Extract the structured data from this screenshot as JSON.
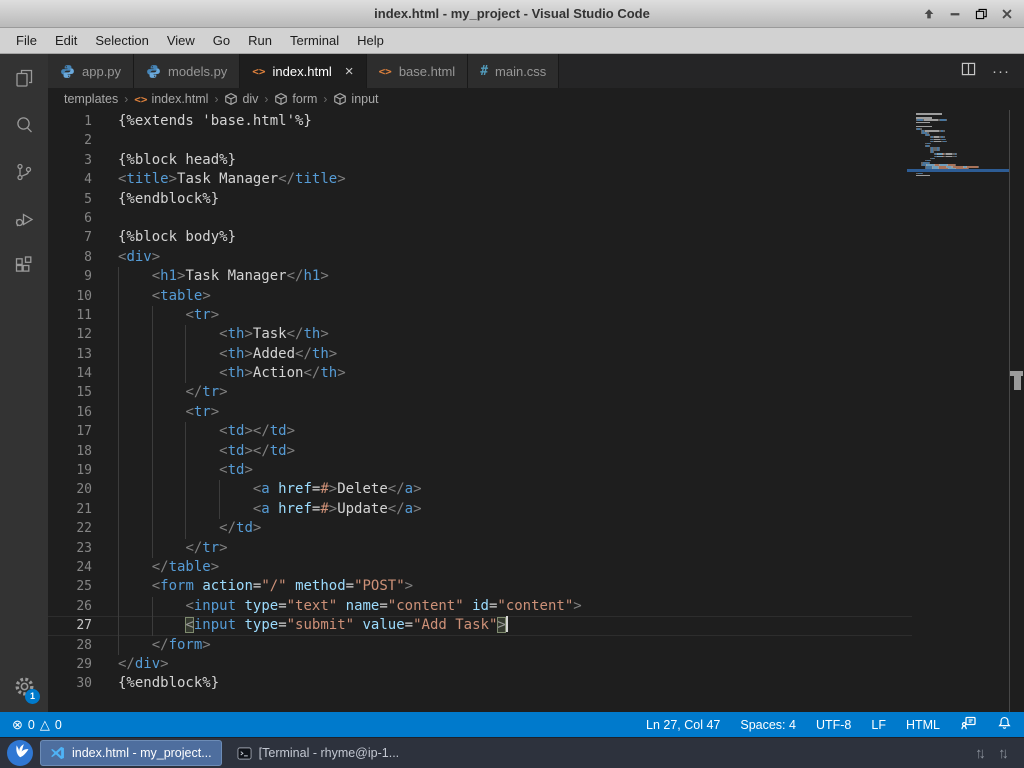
{
  "window": {
    "title": "index.html - my_project - Visual Studio Code"
  },
  "window_controls": [
    {
      "name": "shade-button",
      "icon": "arrow-up-icon"
    },
    {
      "name": "minimize-button",
      "icon": "minimize-icon"
    },
    {
      "name": "maximize-button",
      "icon": "maximize-icon"
    },
    {
      "name": "close-button",
      "icon": "close-icon"
    }
  ],
  "menubar": {
    "items": [
      "File",
      "Edit",
      "Selection",
      "View",
      "Go",
      "Run",
      "Terminal",
      "Help"
    ]
  },
  "activitybar": {
    "items": [
      "explorer",
      "search",
      "source-control",
      "run-debug",
      "extensions"
    ],
    "settings_icon": "gear-icon",
    "settings_badge": "1"
  },
  "tabs": [
    {
      "label": "app.py",
      "icon": "python-icon",
      "active": false
    },
    {
      "label": "models.py",
      "icon": "python-icon",
      "active": false
    },
    {
      "label": "index.html",
      "icon": "html-icon",
      "active": true,
      "close_label": "×"
    },
    {
      "label": "base.html",
      "icon": "html-icon",
      "active": false
    },
    {
      "label": "main.css",
      "icon": "css-icon",
      "active": false
    }
  ],
  "tab_actions": {
    "split_icon": "split-editor-icon",
    "more_label": "···"
  },
  "breadcrumb": {
    "separator": "›",
    "items": [
      {
        "label": "templates",
        "icon": null
      },
      {
        "label": "index.html",
        "icon": "html-icon"
      },
      {
        "label": "div",
        "icon": "symbol-cube-icon"
      },
      {
        "label": "form",
        "icon": "symbol-cube-icon"
      },
      {
        "label": "input",
        "icon": "symbol-cube-icon"
      }
    ]
  },
  "editor": {
    "active_line": 27,
    "lines": [
      {
        "n": 1,
        "indent": 0,
        "t": [
          [
            "p",
            "{%extends 'base.html'%}"
          ]
        ]
      },
      {
        "n": 2,
        "indent": 0,
        "t": []
      },
      {
        "n": 3,
        "indent": 0,
        "t": [
          [
            "p",
            "{%block head%}"
          ]
        ]
      },
      {
        "n": 4,
        "indent": 0,
        "t": [
          [
            "b",
            "<"
          ],
          [
            "t",
            "title"
          ],
          [
            "b",
            ">"
          ],
          [
            "p",
            "Task Manager"
          ],
          [
            "b",
            "</"
          ],
          [
            "t",
            "title"
          ],
          [
            "b",
            ">"
          ]
        ]
      },
      {
        "n": 5,
        "indent": 0,
        "t": [
          [
            "p",
            "{%endblock%}"
          ]
        ]
      },
      {
        "n": 6,
        "indent": 0,
        "t": []
      },
      {
        "n": 7,
        "indent": 0,
        "t": [
          [
            "p",
            "{%block body%}"
          ]
        ]
      },
      {
        "n": 8,
        "indent": 0,
        "t": [
          [
            "b",
            "<"
          ],
          [
            "t",
            "div"
          ],
          [
            "b",
            ">"
          ]
        ]
      },
      {
        "n": 9,
        "indent": 4,
        "t": [
          [
            "b",
            "<"
          ],
          [
            "t",
            "h1"
          ],
          [
            "b",
            ">"
          ],
          [
            "p",
            "Task Manager"
          ],
          [
            "b",
            "</"
          ],
          [
            "t",
            "h1"
          ],
          [
            "b",
            ">"
          ]
        ]
      },
      {
        "n": 10,
        "indent": 4,
        "t": [
          [
            "b",
            "<"
          ],
          [
            "t",
            "table"
          ],
          [
            "b",
            ">"
          ]
        ]
      },
      {
        "n": 11,
        "indent": 8,
        "t": [
          [
            "b",
            "<"
          ],
          [
            "t",
            "tr"
          ],
          [
            "b",
            ">"
          ]
        ]
      },
      {
        "n": 12,
        "indent": 12,
        "t": [
          [
            "b",
            "<"
          ],
          [
            "t",
            "th"
          ],
          [
            "b",
            ">"
          ],
          [
            "p",
            "Task"
          ],
          [
            "b",
            "</"
          ],
          [
            "t",
            "th"
          ],
          [
            "b",
            ">"
          ]
        ]
      },
      {
        "n": 13,
        "indent": 12,
        "t": [
          [
            "b",
            "<"
          ],
          [
            "t",
            "th"
          ],
          [
            "b",
            ">"
          ],
          [
            "p",
            "Added"
          ],
          [
            "b",
            "</"
          ],
          [
            "t",
            "th"
          ],
          [
            "b",
            ">"
          ]
        ]
      },
      {
        "n": 14,
        "indent": 12,
        "t": [
          [
            "b",
            "<"
          ],
          [
            "t",
            "th"
          ],
          [
            "b",
            ">"
          ],
          [
            "p",
            "Action"
          ],
          [
            "b",
            "</"
          ],
          [
            "t",
            "th"
          ],
          [
            "b",
            ">"
          ]
        ]
      },
      {
        "n": 15,
        "indent": 8,
        "t": [
          [
            "b",
            "</"
          ],
          [
            "t",
            "tr"
          ],
          [
            "b",
            ">"
          ]
        ]
      },
      {
        "n": 16,
        "indent": 8,
        "t": [
          [
            "b",
            "<"
          ],
          [
            "t",
            "tr"
          ],
          [
            "b",
            ">"
          ]
        ]
      },
      {
        "n": 17,
        "indent": 12,
        "t": [
          [
            "b",
            "<"
          ],
          [
            "t",
            "td"
          ],
          [
            "b",
            ">"
          ],
          [
            "b",
            "</"
          ],
          [
            "t",
            "td"
          ],
          [
            "b",
            ">"
          ]
        ]
      },
      {
        "n": 18,
        "indent": 12,
        "t": [
          [
            "b",
            "<"
          ],
          [
            "t",
            "td"
          ],
          [
            "b",
            ">"
          ],
          [
            "b",
            "</"
          ],
          [
            "t",
            "td"
          ],
          [
            "b",
            ">"
          ]
        ]
      },
      {
        "n": 19,
        "indent": 12,
        "t": [
          [
            "b",
            "<"
          ],
          [
            "t",
            "td"
          ],
          [
            "b",
            ">"
          ]
        ]
      },
      {
        "n": 20,
        "indent": 16,
        "t": [
          [
            "b",
            "<"
          ],
          [
            "t",
            "a"
          ],
          [
            "p",
            " "
          ],
          [
            "a",
            "href"
          ],
          [
            "p",
            "="
          ],
          [
            "v",
            "#"
          ],
          [
            "b",
            ">"
          ],
          [
            "p",
            "Delete"
          ],
          [
            "b",
            "</"
          ],
          [
            "t",
            "a"
          ],
          [
            "b",
            ">"
          ]
        ]
      },
      {
        "n": 21,
        "indent": 16,
        "t": [
          [
            "b",
            "<"
          ],
          [
            "t",
            "a"
          ],
          [
            "p",
            " "
          ],
          [
            "a",
            "href"
          ],
          [
            "p",
            "="
          ],
          [
            "v",
            "#"
          ],
          [
            "b",
            ">"
          ],
          [
            "p",
            "Update"
          ],
          [
            "b",
            "</"
          ],
          [
            "t",
            "a"
          ],
          [
            "b",
            ">"
          ]
        ]
      },
      {
        "n": 22,
        "indent": 12,
        "t": [
          [
            "b",
            "</"
          ],
          [
            "t",
            "td"
          ],
          [
            "b",
            ">"
          ]
        ]
      },
      {
        "n": 23,
        "indent": 8,
        "t": [
          [
            "b",
            "</"
          ],
          [
            "t",
            "tr"
          ],
          [
            "b",
            ">"
          ]
        ]
      },
      {
        "n": 24,
        "indent": 4,
        "t": [
          [
            "b",
            "</"
          ],
          [
            "t",
            "table"
          ],
          [
            "b",
            ">"
          ]
        ]
      },
      {
        "n": 25,
        "indent": 4,
        "t": [
          [
            "b",
            "<"
          ],
          [
            "t",
            "form"
          ],
          [
            "p",
            " "
          ],
          [
            "a",
            "action"
          ],
          [
            "p",
            "="
          ],
          [
            "v",
            "\"/\""
          ],
          [
            "p",
            " "
          ],
          [
            "a",
            "method"
          ],
          [
            "p",
            "="
          ],
          [
            "v",
            "\"POST\""
          ],
          [
            "b",
            ">"
          ]
        ]
      },
      {
        "n": 26,
        "indent": 8,
        "t": [
          [
            "b",
            "<"
          ],
          [
            "t",
            "input"
          ],
          [
            "p",
            " "
          ],
          [
            "a",
            "type"
          ],
          [
            "p",
            "="
          ],
          [
            "v",
            "\"text\""
          ],
          [
            "p",
            " "
          ],
          [
            "a",
            "name"
          ],
          [
            "p",
            "="
          ],
          [
            "v",
            "\"content\""
          ],
          [
            "p",
            " "
          ],
          [
            "a",
            "id"
          ],
          [
            "p",
            "="
          ],
          [
            "v",
            "\"content\""
          ],
          [
            "b",
            ">"
          ]
        ]
      },
      {
        "n": 27,
        "indent": 8,
        "t": [
          [
            "bm",
            "<"
          ],
          [
            "t",
            "input"
          ],
          [
            "p",
            " "
          ],
          [
            "a",
            "type"
          ],
          [
            "p",
            "="
          ],
          [
            "v",
            "\"submit\""
          ],
          [
            "p",
            " "
          ],
          [
            "a",
            "value"
          ],
          [
            "p",
            "="
          ],
          [
            "v",
            "\"Add Task\""
          ],
          [
            "bm",
            ">"
          ],
          [
            "cur",
            ""
          ]
        ]
      },
      {
        "n": 28,
        "indent": 4,
        "t": [
          [
            "b",
            "</"
          ],
          [
            "t",
            "form"
          ],
          [
            "b",
            ">"
          ]
        ]
      },
      {
        "n": 29,
        "indent": 0,
        "t": [
          [
            "b",
            "</"
          ],
          [
            "t",
            "div"
          ],
          [
            "b",
            ">"
          ]
        ]
      },
      {
        "n": 30,
        "indent": 0,
        "t": [
          [
            "p",
            "{%endblock%}"
          ]
        ]
      }
    ]
  },
  "statusbar": {
    "errors": "0",
    "warnings": "0",
    "items": [
      "Ln 27, Col 47",
      "Spaces: 4",
      "UTF-8",
      "LF",
      "HTML"
    ],
    "right_icons": [
      "feedback-icon",
      "bell-icon"
    ]
  },
  "taskbar": {
    "tasks": [
      {
        "label": "index.html - my_project...",
        "icon": "vscode-icon",
        "active": true
      },
      {
        "label": "[Terminal - rhyme@ip-1...",
        "icon": "terminal-icon",
        "active": false
      }
    ],
    "right_icons": [
      "network-traffic-icon",
      "network-traffic-icon"
    ]
  },
  "colors": {
    "accent": "#007acc",
    "editor_bg": "#1e1e1e",
    "tag": "#569cd6",
    "attribute": "#9cdcfe",
    "string": "#ce9178",
    "punctuation": "#808080",
    "text": "#d4d4d4",
    "taskbar_active": "#4e6e9e"
  }
}
